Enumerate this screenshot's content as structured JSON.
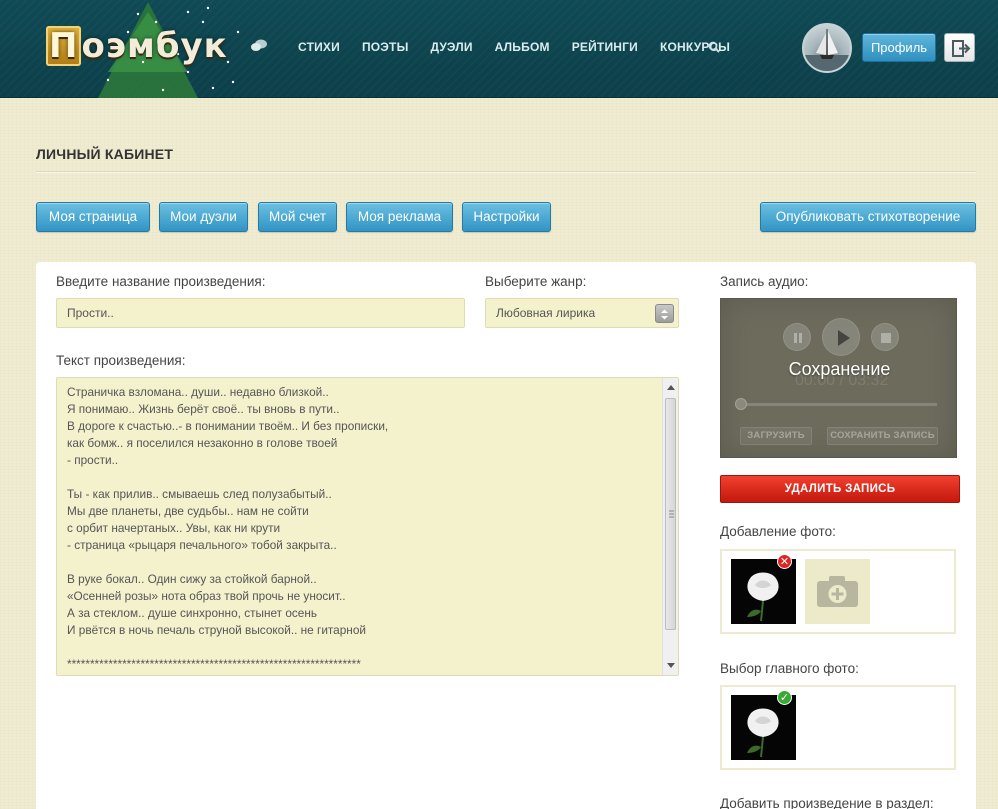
{
  "header": {
    "logo_text": "Поэмбук",
    "nav": [
      "СТИХИ",
      "ПОЭТЫ",
      "ДУЭЛИ",
      "АЛЬБОМ",
      "РЕЙТИНГИ",
      "КОНКУРСЫ"
    ],
    "profile_label": "Профиль"
  },
  "page": {
    "title": "ЛИЧНЫЙ КАБИНЕТ"
  },
  "tabs": {
    "my_page": "Моя страница",
    "my_duels": "Мои дуэли",
    "my_account": "Мой счет",
    "my_ads": "Моя реклама",
    "settings": "Настройки",
    "publish": "Опубликовать стихотворение"
  },
  "form": {
    "title_label": "Введите название произведения:",
    "title_value": "Прости..",
    "genre_label": "Выберите жанр:",
    "genre_value": "Любовная лирика",
    "text_label": "Текст произведения:",
    "text_value": "Страничка взломана.. души.. недавно близкой..\nЯ понимаю.. Жизнь берёт своё.. ты вновь в пути..\nВ дороге к счастью..- в понимании твоём.. И без прописки,\nкак бомж.. я поселился незаконно в голове твоей\n- прости..\n\nТы - как прилив.. смываешь след полузабытый..\nМы две планеты, две судьбы.. нам не сойти\nс орбит начертаных.. Увы, как ни крути\n- страница «рыцаря печального» тобой закрыта..\n\nВ руке бокал.. Один сижу за стойкой барной..\n«Осенней розы» нота образ твой прочь не уносит..\nА за стеклом.. душе синхронно, стынет осень\nИ рвётся в ночь печаль струной высокой.. не гитарной\n\n****************************************************************"
  },
  "audio": {
    "label": "Запись аудио:",
    "status": "Сохранение",
    "timer": "00:00 / 03:32",
    "upload_label": "ЗАГРУЗИТЬ",
    "save_label": "СОХРАНИТЬ ЗАПИСЬ",
    "delete_label": "УДАЛИТЬ ЗАПИСЬ"
  },
  "photos": {
    "add_label": "Добавление фото:",
    "main_label": "Выбор главного фото:",
    "section_label": "Добавить произведение в раздел:"
  },
  "colors": {
    "header_bg": "#0f4a55",
    "button_blue": "#3294c4",
    "delete_red": "#d0271a",
    "page_bg": "#efecd0"
  }
}
